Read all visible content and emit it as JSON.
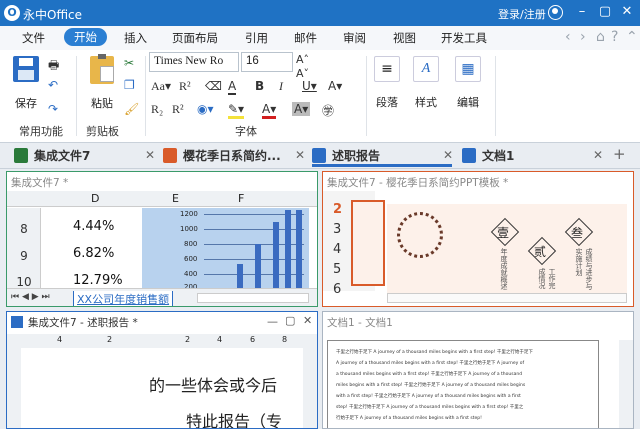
{
  "app": {
    "title": "永中Office",
    "login": "登录/注册"
  },
  "menu": {
    "items": [
      "文件",
      "开始",
      "插入",
      "页面布局",
      "引用",
      "邮件",
      "审阅",
      "视图",
      "开发工具"
    ],
    "active": "开始"
  },
  "ribbon": {
    "save": "保存",
    "paste": "粘贴",
    "font_name": "Times New Ro",
    "font_size": "16",
    "paragraph": "段落",
    "style": "样式",
    "edit": "编辑",
    "groups": {
      "common": "常用功能",
      "clipboard": "剪贴板",
      "font": "字体"
    }
  },
  "tabs": [
    {
      "label": "集成文件7",
      "color": "#2a7a3a"
    },
    {
      "label": "樱花季日系简约...",
      "color": "#d95b2a"
    },
    {
      "label": "述职报告",
      "color": "#2b6cc4"
    },
    {
      "label": "文档1",
      "color": "#2b6cc4"
    }
  ],
  "panes": {
    "sheet": {
      "title": "集成文件7 *",
      "cols": [
        "D",
        "E",
        "F"
      ],
      "rows": [
        "8",
        "9",
        "10"
      ],
      "values": [
        "4.44%",
        "6.82%",
        "12.79%"
      ],
      "axis": [
        "1200",
        "1000",
        "800",
        "600",
        "400",
        "200"
      ],
      "sheet_tab": "XX公司年度销售额"
    },
    "ppt": {
      "title": "集成文件7 - 樱花季日系简约PPT模板 *",
      "slides": [
        "2",
        "3",
        "4",
        "5",
        "6"
      ],
      "chars": [
        "壹",
        "贰",
        "叁"
      ],
      "v1": "年度成就概述",
      "v2": "工作完成情况",
      "v3": "成绩与进步与实施计划"
    },
    "doc": {
      "title": "集成文件7 - 述职报告 *",
      "line1": "的一些体会或今后",
      "line2": "特此报告（专",
      "ruler": [
        "4",
        "2",
        "2",
        "4",
        "6",
        "8"
      ]
    },
    "doc1": {
      "title": "文档1 - 文档1",
      "lines": [
        "千里之行始于足下 A journey of a thousand miles begins with a first step! 千里之行始于足下",
        "A journey of a thousand miles begins with a first step! 千里之行始于足下 A journey of",
        "a thousand miles begins with a first step! 千里之行始于足下 A journey of a thousand",
        "miles begins with a first step! 千里之行始于足下 A journey of a thousand miles begins",
        "with a first step! 千里之行始于足下 A journey of a thousand miles begins with a first",
        "step! 千里之行始于足下 A journey of a thousand miles begins with a first step! 千里之",
        "行始于足下 A journey of a thousand miles begins with a first step!"
      ]
    }
  }
}
